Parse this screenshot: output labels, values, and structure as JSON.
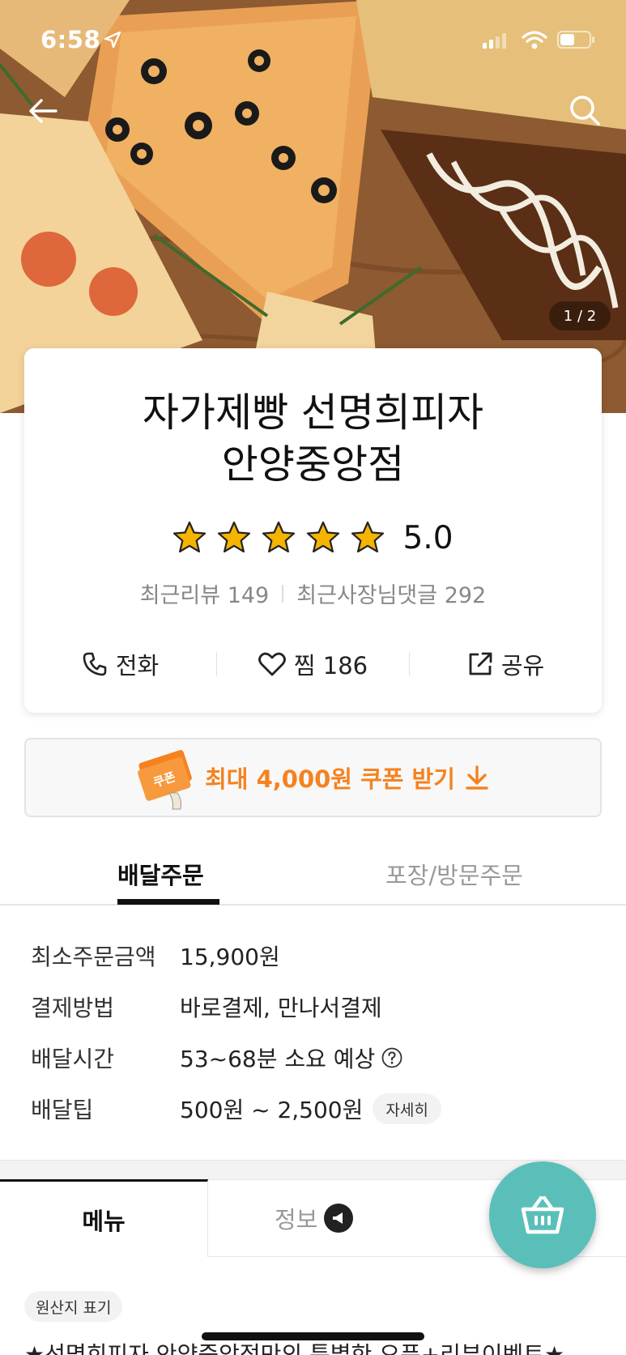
{
  "status_bar": {
    "time": "6:58"
  },
  "hero": {
    "image_counter": "1 / 2"
  },
  "store": {
    "name_line1": "자가제빵 선명희피자",
    "name_line2": "안양중앙점",
    "rating": "5.0",
    "stars": 5,
    "recent_reviews": "최근리뷰 149",
    "owner_replies": "최근사장님댓글 292"
  },
  "actions": {
    "call": "전화",
    "like": "찜 186",
    "share": "공유"
  },
  "coupon": {
    "text": "최대 4,000원 쿠폰 받기",
    "ticket_label": "쿠폰"
  },
  "order_tabs": {
    "delivery": "배달주문",
    "pickup": "포장/방문주문"
  },
  "info": {
    "min_order_label": "최소주문금액",
    "min_order_value": "15,900원",
    "payment_label": "결제방법",
    "payment_value": "바로결제, 만나서결제",
    "delivery_time_label": "배달시간",
    "delivery_time_value": "53~68분 소요 예상",
    "delivery_tip_label": "배달팁",
    "delivery_tip_value": "500원 ~ 2,500원",
    "detail_button": "자세히"
  },
  "menu_tabs": {
    "menu": "메뉴",
    "info": "정보"
  },
  "origin_chip": "원산지 표기",
  "promo_text": "★선명희피자 안양중앙점만의 특별한 오픈+리뷰이벤트★",
  "colors": {
    "accent_orange": "#f5821f",
    "cart_teal": "#5bbfb9",
    "star_gold": "#f4b400"
  }
}
